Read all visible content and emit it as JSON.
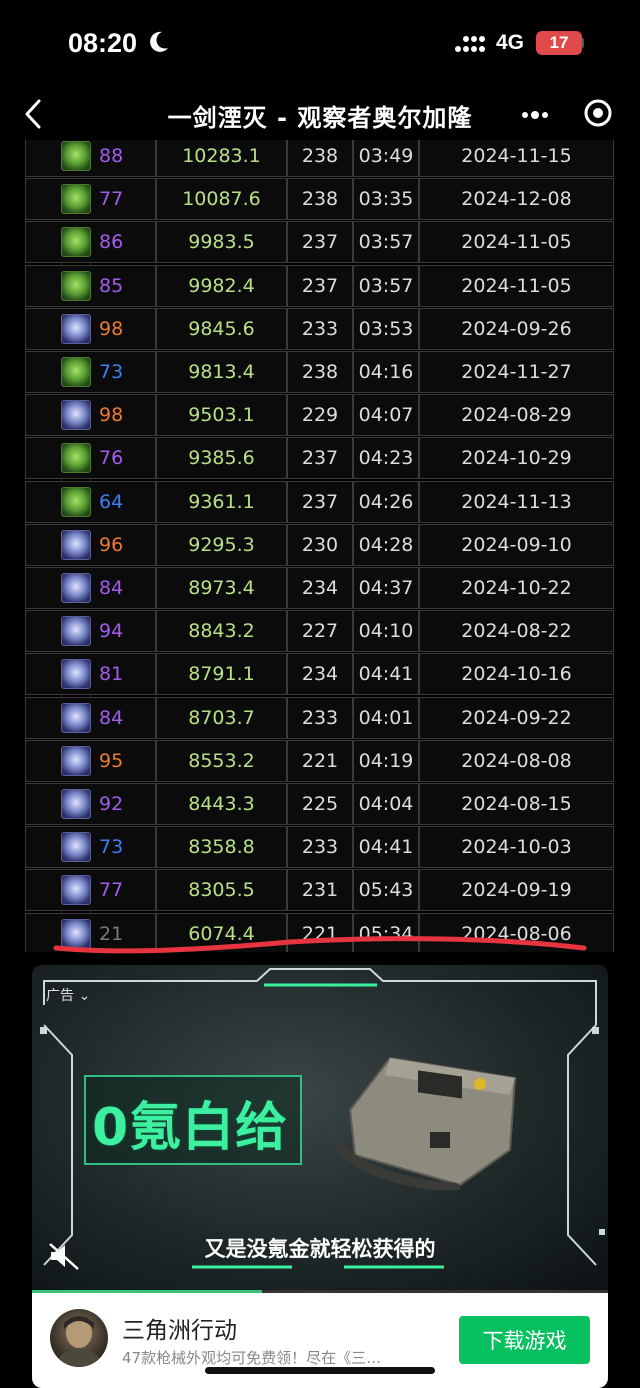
{
  "status": {
    "time": "08:20",
    "network": "4G",
    "battery": "17"
  },
  "nav": {
    "title": "一剑湮灭 - 观察者奥尔加隆"
  },
  "colors": {
    "ilvl_purple": "#a45bf0",
    "ilvl_orange": "#ee7a2c",
    "ilvl_blue": "#3d7ef2",
    "ilvl_gray": "#7a7a7a",
    "dps_green": "#b7e086",
    "accent_green": "#07c160"
  },
  "table": {
    "rows": [
      {
        "spec": "green",
        "ilvl": "88",
        "ilvl_color": "#a45bf0",
        "dps": "10283.1",
        "gear": "238",
        "time": "03:49",
        "date": "2024-11-15"
      },
      {
        "spec": "green",
        "ilvl": "77",
        "ilvl_color": "#a45bf0",
        "dps": "10087.6",
        "gear": "238",
        "time": "03:35",
        "date": "2024-12-08"
      },
      {
        "spec": "green",
        "ilvl": "86",
        "ilvl_color": "#a45bf0",
        "dps": "9983.5",
        "gear": "237",
        "time": "03:57",
        "date": "2024-11-05"
      },
      {
        "spec": "green",
        "ilvl": "85",
        "ilvl_color": "#a45bf0",
        "dps": "9982.4",
        "gear": "237",
        "time": "03:57",
        "date": "2024-11-05"
      },
      {
        "spec": "blue",
        "ilvl": "98",
        "ilvl_color": "#ee7a2c",
        "dps": "9845.6",
        "gear": "233",
        "time": "03:53",
        "date": "2024-09-26"
      },
      {
        "spec": "green",
        "ilvl": "73",
        "ilvl_color": "#3d7ef2",
        "dps": "9813.4",
        "gear": "238",
        "time": "04:16",
        "date": "2024-11-27"
      },
      {
        "spec": "blue",
        "ilvl": "98",
        "ilvl_color": "#ee7a2c",
        "dps": "9503.1",
        "gear": "229",
        "time": "04:07",
        "date": "2024-08-29"
      },
      {
        "spec": "green",
        "ilvl": "76",
        "ilvl_color": "#a45bf0",
        "dps": "9385.6",
        "gear": "237",
        "time": "04:23",
        "date": "2024-10-29"
      },
      {
        "spec": "green",
        "ilvl": "64",
        "ilvl_color": "#3d7ef2",
        "dps": "9361.1",
        "gear": "237",
        "time": "04:26",
        "date": "2024-11-13"
      },
      {
        "spec": "blue",
        "ilvl": "96",
        "ilvl_color": "#ee7a2c",
        "dps": "9295.3",
        "gear": "230",
        "time": "04:28",
        "date": "2024-09-10"
      },
      {
        "spec": "blue",
        "ilvl": "84",
        "ilvl_color": "#a45bf0",
        "dps": "8973.4",
        "gear": "234",
        "time": "04:37",
        "date": "2024-10-22"
      },
      {
        "spec": "blue",
        "ilvl": "94",
        "ilvl_color": "#a45bf0",
        "dps": "8843.2",
        "gear": "227",
        "time": "04:10",
        "date": "2024-08-22"
      },
      {
        "spec": "blue",
        "ilvl": "81",
        "ilvl_color": "#a45bf0",
        "dps": "8791.1",
        "gear": "234",
        "time": "04:41",
        "date": "2024-10-16"
      },
      {
        "spec": "blue",
        "ilvl": "84",
        "ilvl_color": "#a45bf0",
        "dps": "8703.7",
        "gear": "233",
        "time": "04:01",
        "date": "2024-09-22"
      },
      {
        "spec": "blue",
        "ilvl": "95",
        "ilvl_color": "#ee7a2c",
        "dps": "8553.2",
        "gear": "221",
        "time": "04:19",
        "date": "2024-08-08"
      },
      {
        "spec": "blue",
        "ilvl": "92",
        "ilvl_color": "#a45bf0",
        "dps": "8443.3",
        "gear": "225",
        "time": "04:04",
        "date": "2024-08-15"
      },
      {
        "spec": "blue",
        "ilvl": "73",
        "ilvl_color": "#3d7ef2",
        "dps": "8358.8",
        "gear": "233",
        "time": "04:41",
        "date": "2024-10-03"
      },
      {
        "spec": "blue",
        "ilvl": "77",
        "ilvl_color": "#a45bf0",
        "dps": "8305.5",
        "gear": "231",
        "time": "05:43",
        "date": "2024-09-19"
      },
      {
        "spec": "blue",
        "ilvl": "21",
        "ilvl_color": "#7a7a7a",
        "dps": "6074.4",
        "gear": "221",
        "time": "05:34",
        "date": "2024-08-06"
      }
    ]
  },
  "ad": {
    "label": "广告",
    "promo": "0氪白给",
    "subtitle": "又是没氪金就轻松获得的",
    "progress": 0.4,
    "app_name": "三角洲行动",
    "app_desc": "47款枪械外观均可免费领！尽在《三…",
    "download_label": "下载游戏"
  }
}
